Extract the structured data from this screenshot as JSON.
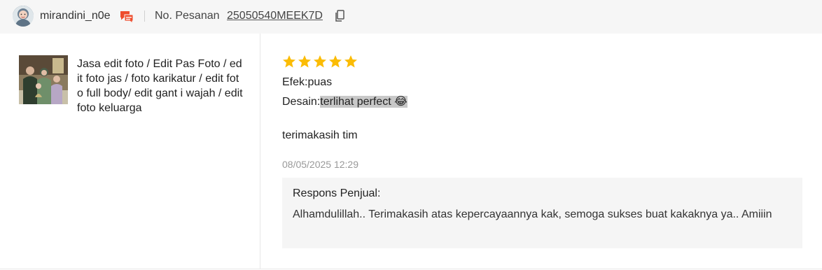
{
  "header": {
    "username": "mirandini_n0e",
    "order_label": "No. Pesanan",
    "order_number": "25050540MEEK7D"
  },
  "product": {
    "name": "Jasa edit foto / Edit Pas Foto / edit foto jas / foto karikatur / edit foto full body/ edit gant i wajah / edit foto keluarga"
  },
  "review": {
    "rating": 5,
    "line1": "Efek:puas",
    "line2_label": "Desain:",
    "line2_value": "terlihat perfect 😂",
    "comment": "terimakasih tim",
    "timestamp": "08/05/2025 12:29"
  },
  "seller_response": {
    "title": "Respons Penjual:",
    "text": "Alhamdulillah.. Terimakasih atas kepercayaannya kak, semoga sukses buat kakaknya ya.. Amiiin"
  },
  "colors": {
    "star": "#fbbc05",
    "chat_icon": "#ee4d2d",
    "header_bg": "#f6f6f6"
  },
  "icons": {
    "chat": "chat-icon",
    "copy": "copy-icon",
    "star": "star-icon"
  }
}
